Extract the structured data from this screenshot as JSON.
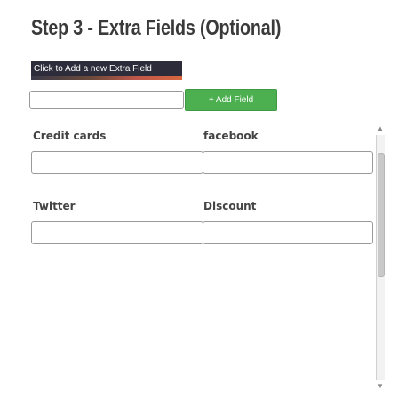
{
  "page": {
    "title": "Step 3 - Extra Fields (Optional)"
  },
  "banner": {
    "text": "Click to Add a new Extra Field"
  },
  "new_field": {
    "value": "",
    "placeholder": "",
    "add_button_label": "+ Add Field"
  },
  "fields": [
    {
      "label": "Credit cards",
      "value": ""
    },
    {
      "label": "facebook",
      "value": ""
    },
    {
      "label": "Twitter",
      "value": ""
    },
    {
      "label": "Discount",
      "value": ""
    }
  ],
  "colors": {
    "add_button": "#4caf50",
    "banner_bg": "#2c2c3a",
    "title": "#3a3a3a"
  }
}
